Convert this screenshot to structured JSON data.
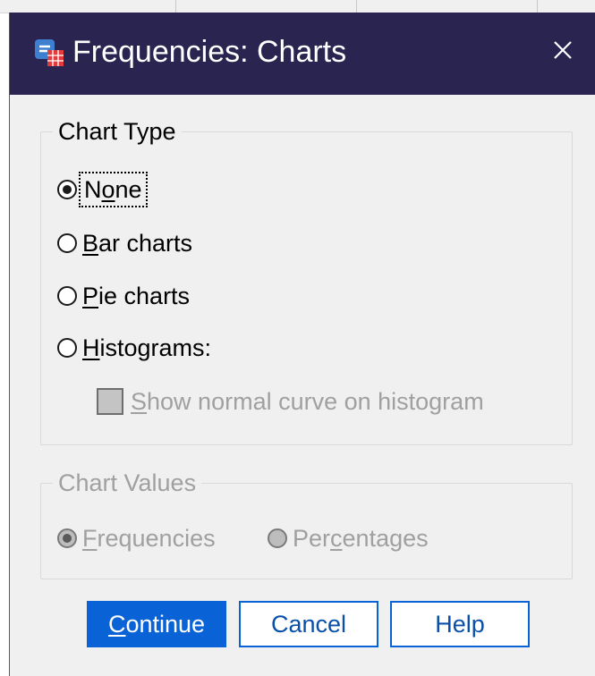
{
  "window": {
    "title": "Frequencies: Charts",
    "app_icon": "spss-app-icon",
    "close_icon": "close-icon"
  },
  "chart_type": {
    "legend": "Chart Type",
    "options": [
      {
        "id": "none",
        "pre": "N",
        "mnemonic": "o",
        "post": "ne",
        "checked": true
      },
      {
        "id": "bar",
        "pre": "",
        "mnemonic": "B",
        "post": "ar charts",
        "checked": false
      },
      {
        "id": "pie",
        "pre": "",
        "mnemonic": "P",
        "post": "ie charts",
        "checked": false
      },
      {
        "id": "histograms",
        "pre": "",
        "mnemonic": "H",
        "post": "istograms:",
        "checked": false
      }
    ],
    "normal_curve": {
      "pre": "",
      "mnemonic": "S",
      "post": "how normal curve on histogram",
      "checked": false,
      "enabled": false
    }
  },
  "chart_values": {
    "legend": "Chart Values",
    "enabled": false,
    "options": [
      {
        "id": "frequencies",
        "pre": "",
        "mnemonic": "F",
        "post": "requencies",
        "checked": true
      },
      {
        "id": "percentages",
        "pre": "Per",
        "mnemonic": "c",
        "post": "entages",
        "checked": false
      }
    ]
  },
  "buttons": {
    "continue": {
      "pre": "",
      "mnemonic": "C",
      "post": "ontinue"
    },
    "cancel": "Cancel",
    "help": "Help"
  },
  "colors": {
    "titlebar": "#2a2550",
    "primary_button": "#0a63d6",
    "dialog_bg": "#f0f0f0",
    "disabled_text": "#a0a0a0"
  }
}
